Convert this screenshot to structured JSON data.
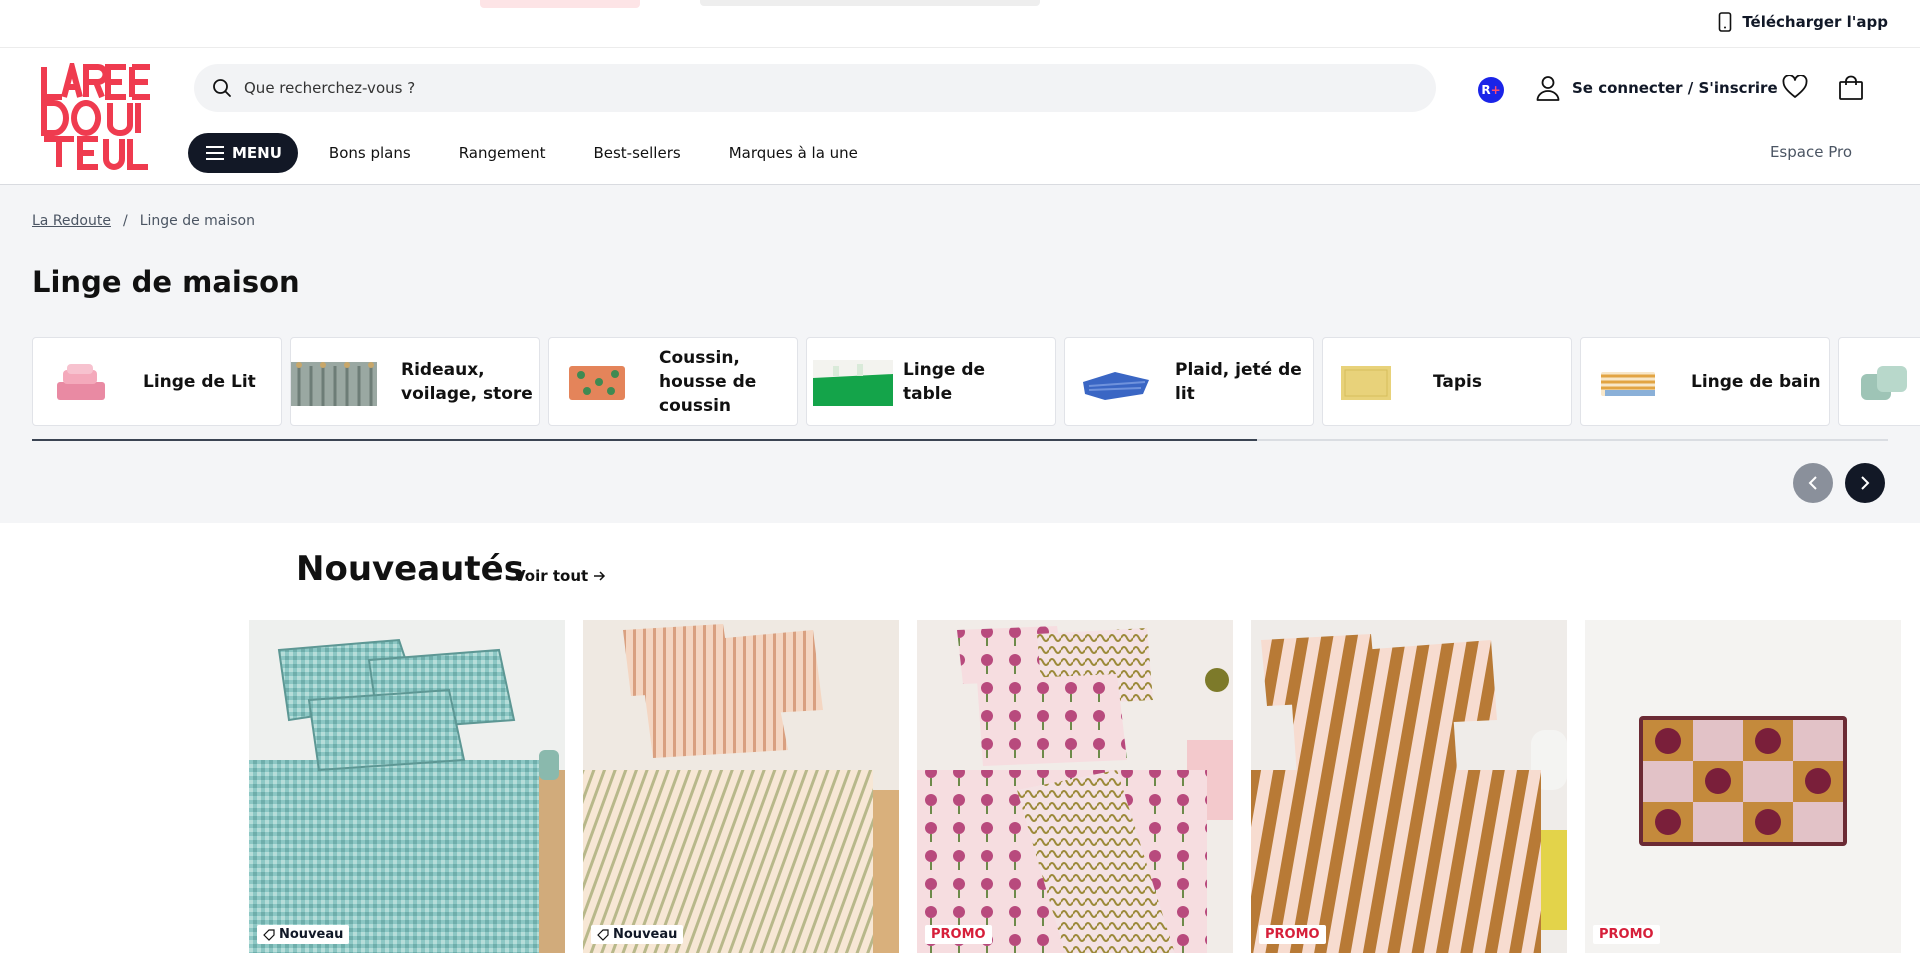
{
  "top_bar": {
    "app_label": "Télécharger l'app"
  },
  "header": {
    "brand_name": "LA REDOUTE",
    "search_placeholder": "Que recherchez-vous ?",
    "rplus_label": "R",
    "rplus_plus": "+",
    "account_label": "Se connecter / S'inscrire"
  },
  "nav": {
    "menu_label": "MENU",
    "items": [
      "Bons plans",
      "Rangement",
      "Best-sellers",
      "Marques à la une"
    ],
    "espace_pro": "Espace Pro"
  },
  "breadcrumb": {
    "home": "La Redoute",
    "separator": "/",
    "current": "Linge de maison"
  },
  "page_title": "Linge de maison",
  "categories": [
    {
      "label": "Linge de Lit",
      "icon": "pink-bedding-thumb"
    },
    {
      "label": "Rideaux, voilage, store",
      "icon": "curtain-thumb"
    },
    {
      "label": "Coussin, housse de coussin",
      "icon": "cushion-thumb"
    },
    {
      "label": "Linge de table",
      "icon": "green-tablecloth-thumb"
    },
    {
      "label": "Plaid, jeté de lit",
      "icon": "blue-throw-thumb"
    },
    {
      "label": "Tapis",
      "icon": "yellow-rug-thumb"
    },
    {
      "label": "Linge de bain",
      "icon": "striped-towels-thumb"
    },
    {
      "label": "",
      "icon": "green-cushions-thumb"
    }
  ],
  "carousel_progress": 0.66,
  "new_section": {
    "title": "Nouveautés",
    "see_all": "Voir tout"
  },
  "products": [
    {
      "badge": "Nouveau",
      "badge_type": "new",
      "image": "teal-gingham-bedding"
    },
    {
      "badge": "Nouveau",
      "badge_type": "new",
      "image": "peach-striped-bedding"
    },
    {
      "badge": "PROMO",
      "badge_type": "promo",
      "image": "floral-pink-bedding"
    },
    {
      "badge": "PROMO",
      "badge_type": "promo",
      "image": "caramel-striped-bedding"
    },
    {
      "badge": "PROMO",
      "badge_type": "promo",
      "image": "checkered-cushion"
    }
  ],
  "colors": {
    "brand_red": "#ef3b4f",
    "dark_navy": "#121826",
    "promo_red": "#d61f3a",
    "rplus_blue": "#1a24e8"
  }
}
